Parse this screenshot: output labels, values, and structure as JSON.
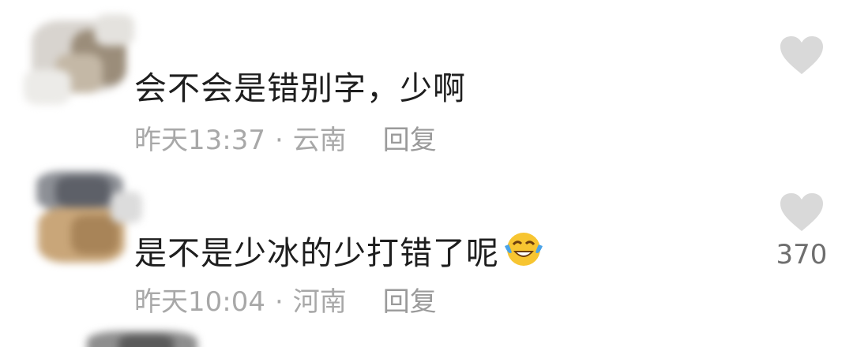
{
  "comments": [
    {
      "text": "会不会是错别字，少啊",
      "time": "昨天13:37",
      "location": "云南",
      "reply_label": "回复",
      "like_count": "",
      "avatar_icon": "blurred-avatar",
      "like_icon": "heart-icon"
    },
    {
      "text": "是不是少冰的少打错了呢",
      "time": "昨天10:04",
      "location": "河南",
      "reply_label": "回复",
      "like_count": "370",
      "avatar_icon": "blurred-avatar",
      "like_icon": "heart-icon",
      "emoji": "laughing-tears-emoji"
    }
  ],
  "separator": "·",
  "colors": {
    "text": "#1e1e1e",
    "meta": "#a8a8a8",
    "heart": "#d9d9d9",
    "emoji_face": "#f7c531"
  }
}
